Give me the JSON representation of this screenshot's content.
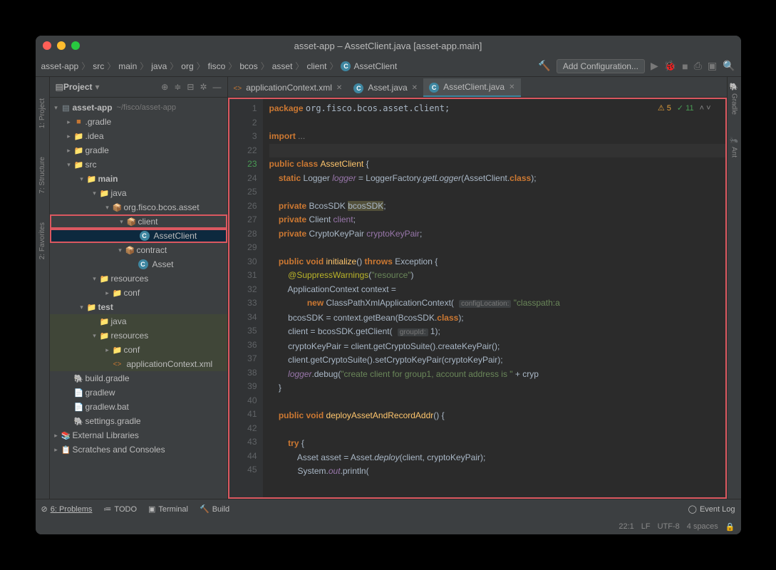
{
  "window": {
    "title": "asset-app – AssetClient.java [asset-app.main]"
  },
  "breadcrumbs": [
    "asset-app",
    "src",
    "main",
    "java",
    "org",
    "fisco",
    "bcos",
    "asset",
    "client",
    "AssetClient"
  ],
  "toolbar": {
    "add_config": "Add Configuration..."
  },
  "sidebar": {
    "tabs": {
      "project": "1: Project",
      "structure": "7: Structure",
      "favorites": "2: Favorites"
    }
  },
  "rightbar": {
    "tabs": {
      "gradle": "Gradle",
      "ant": "Ant"
    }
  },
  "project_panel": {
    "title": "Project",
    "root": {
      "name": "asset-app",
      "path": "~/fisco/asset-app"
    },
    "items": {
      "dot_gradle": ".gradle",
      "dot_idea": ".idea",
      "gradle": "gradle",
      "src": "src",
      "main_dir": "main",
      "java_dir": "java",
      "pkg": "org.fisco.bcos.asset",
      "client_pkg": "client",
      "asset_client": "AssetClient",
      "contract_pkg": "contract",
      "asset": "Asset",
      "resources": "resources",
      "conf": "conf",
      "test": "test",
      "test_java": "java",
      "test_resources": "resources",
      "test_conf": "conf",
      "app_ctx": "applicationContext.xml",
      "build_gradle": "build.gradle",
      "gradlew": "gradlew",
      "gradlew_bat": "gradlew.bat",
      "settings_gradle": "settings.gradle",
      "ext_libs": "External Libraries",
      "scratches": "Scratches and Consoles"
    }
  },
  "tabs": [
    {
      "name": "applicationContext.xml",
      "type": "xml"
    },
    {
      "name": "Asset.java",
      "type": "java"
    },
    {
      "name": "AssetClient.java",
      "type": "java",
      "active": true
    }
  ],
  "inspection": {
    "warn": "5",
    "ok": "11"
  },
  "gutter_lines": [
    "1",
    "2",
    "3",
    "22",
    "23",
    "24",
    "25",
    "26",
    "27",
    "28",
    "29",
    "30",
    "31",
    "32",
    "33",
    "34",
    "35",
    "36",
    "37",
    "38",
    "39",
    "40",
    "41",
    "42",
    "43",
    "44",
    "45"
  ],
  "code": {
    "l1": "package org.fisco.bcos.asset.client;",
    "l3": "import ...",
    "l23a": "public class ",
    "l23b": "AssetClient",
    "l23c": " {",
    "l24a": "    static ",
    "l24b": "Logger ",
    "l24c": "logger",
    "l24d": " = LoggerFactory.",
    "l24e": "getLogger",
    "l24f": "(AssetClient.",
    "l24g": "class",
    "l24h": ");",
    "l26a": "    private ",
    "l26b": "BcosSDK ",
    "l26c": "bcosSDK",
    "l26d": ";",
    "l27a": "    private ",
    "l27b": "Client ",
    "l27c": "client",
    "l27d": ";",
    "l28a": "    private ",
    "l28b": "CryptoKeyPair ",
    "l28c": "cryptoKeyPair",
    "l28d": ";",
    "l30a": "    public void ",
    "l30b": "initialize",
    "l30c": "() ",
    "l30d": "throws ",
    "l30e": "Exception {",
    "l31a": "        @SuppressWarnings",
    "l31b": "(",
    "l31c": "\"resource\"",
    "l31d": ")",
    "l32": "        ApplicationContext context =",
    "l33a": "                new ",
    "l33b": "ClassPathXmlApplicationContext(",
    "l33hint": "configLocation:",
    "l33c": " \"classpath:a",
    "l34a": "        bcosSDK = context.getBean(BcosSDK.",
    "l34b": "class",
    "l34c": ");",
    "l35a": "        client = bcosSDK.getClient(",
    "l35hint": "groupId:",
    "l35b": " 1);",
    "l36": "        cryptoKeyPair = client.getCryptoSuite().createKeyPair();",
    "l37": "        client.getCryptoSuite().setCryptoKeyPair(cryptoKeyPair);",
    "l38a": "        logger",
    "l38b": ".debug(",
    "l38c": "\"create client for group1, account address is \"",
    "l38d": " + cryp",
    "l39": "    }",
    "l41a": "    public void ",
    "l41b": "deployAssetAndRecordAddr",
    "l41c": "() {",
    "l43a": "        try ",
    "l43b": "{",
    "l44a": "            Asset asset = Asset.",
    "l44b": "deploy",
    "l44c": "(client, cryptoKeyPair);",
    "l45a": "            System.",
    "l45b": "out",
    "l45c": ".println("
  },
  "status": {
    "problems": "6: Problems",
    "todo": "TODO",
    "terminal": "Terminal",
    "build": "Build",
    "event_log": "Event Log",
    "pos": "22:1",
    "lf": "LF",
    "enc": "UTF-8",
    "indent": "4 spaces"
  }
}
